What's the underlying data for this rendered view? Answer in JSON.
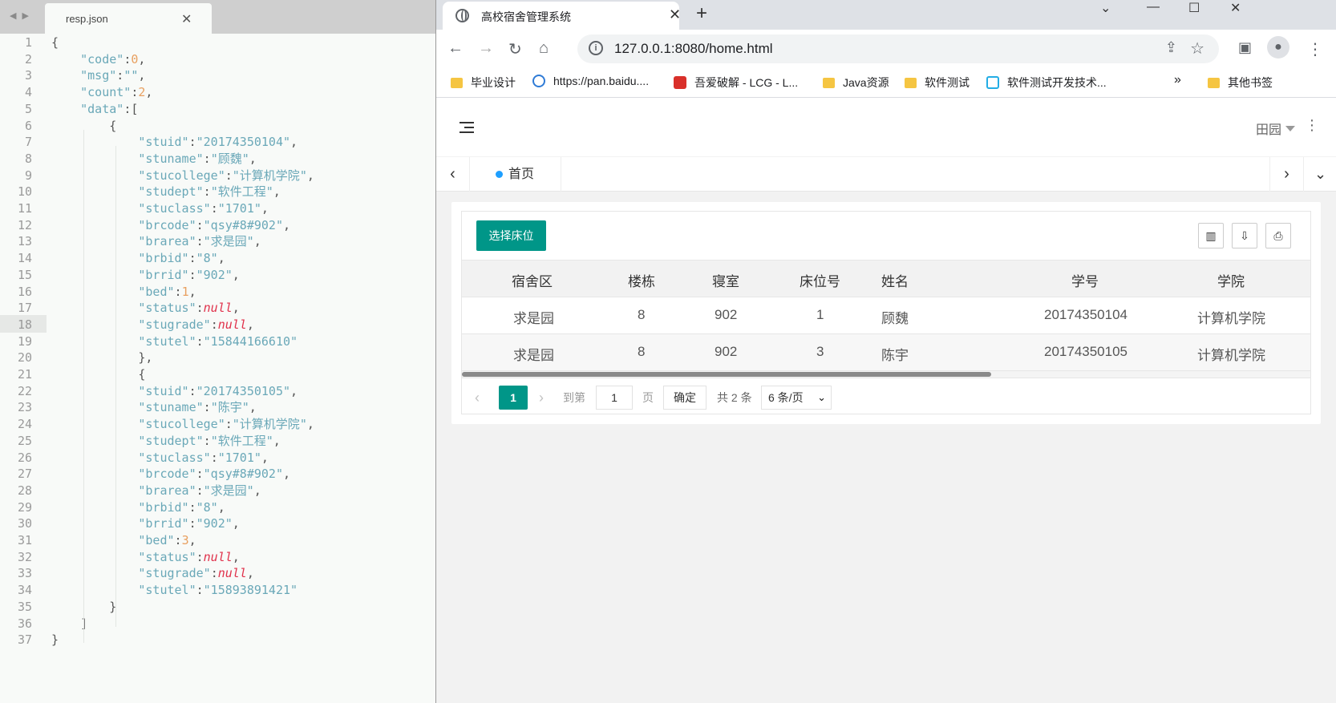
{
  "editor": {
    "file_name": "resp.json",
    "line_numbers": [
      "1",
      "2",
      "3",
      "4",
      "5",
      "6",
      "7",
      "8",
      "9",
      "10",
      "11",
      "12",
      "13",
      "14",
      "15",
      "16",
      "17",
      "18",
      "19",
      "20",
      "21",
      "22",
      "23",
      "24",
      "25",
      "26",
      "27",
      "28",
      "29",
      "30",
      "31",
      "32",
      "33",
      "34",
      "35",
      "36",
      "37"
    ],
    "lines": [
      [
        [
          "p",
          "{"
        ]
      ],
      [
        [
          "p",
          "    "
        ],
        [
          "k",
          "\"code\""
        ],
        [
          "p",
          ":"
        ],
        [
          "n",
          "0"
        ],
        [
          "p",
          ","
        ]
      ],
      [
        [
          "p",
          "    "
        ],
        [
          "k",
          "\"msg\""
        ],
        [
          "p",
          ":"
        ],
        [
          "s",
          "\"\""
        ],
        [
          "p",
          ","
        ]
      ],
      [
        [
          "p",
          "    "
        ],
        [
          "k",
          "\"count\""
        ],
        [
          "p",
          ":"
        ],
        [
          "n",
          "2"
        ],
        [
          "p",
          ","
        ]
      ],
      [
        [
          "p",
          "    "
        ],
        [
          "k",
          "\"data\""
        ],
        [
          "p",
          ":["
        ]
      ],
      [
        [
          "p",
          "        {"
        ]
      ],
      [
        [
          "p",
          "            "
        ],
        [
          "k",
          "\"stuid\""
        ],
        [
          "p",
          ":"
        ],
        [
          "s",
          "\"20174350104\""
        ],
        [
          "p",
          ","
        ]
      ],
      [
        [
          "p",
          "            "
        ],
        [
          "k",
          "\"stuname\""
        ],
        [
          "p",
          ":"
        ],
        [
          "s",
          "\"顾魏\""
        ],
        [
          "p",
          ","
        ]
      ],
      [
        [
          "p",
          "            "
        ],
        [
          "k",
          "\"stucollege\""
        ],
        [
          "p",
          ":"
        ],
        [
          "s",
          "\"计算机学院\""
        ],
        [
          "p",
          ","
        ]
      ],
      [
        [
          "p",
          "            "
        ],
        [
          "k",
          "\"studept\""
        ],
        [
          "p",
          ":"
        ],
        [
          "s",
          "\"软件工程\""
        ],
        [
          "p",
          ","
        ]
      ],
      [
        [
          "p",
          "            "
        ],
        [
          "k",
          "\"stuclass\""
        ],
        [
          "p",
          ":"
        ],
        [
          "s",
          "\"1701\""
        ],
        [
          "p",
          ","
        ]
      ],
      [
        [
          "p",
          "            "
        ],
        [
          "k",
          "\"brcode\""
        ],
        [
          "p",
          ":"
        ],
        [
          "s",
          "\"qsy#8#902\""
        ],
        [
          "p",
          ","
        ]
      ],
      [
        [
          "p",
          "            "
        ],
        [
          "k",
          "\"brarea\""
        ],
        [
          "p",
          ":"
        ],
        [
          "s",
          "\"求是园\""
        ],
        [
          "p",
          ","
        ]
      ],
      [
        [
          "p",
          "            "
        ],
        [
          "k",
          "\"brbid\""
        ],
        [
          "p",
          ":"
        ],
        [
          "s",
          "\"8\""
        ],
        [
          "p",
          ","
        ]
      ],
      [
        [
          "p",
          "            "
        ],
        [
          "k",
          "\"brrid\""
        ],
        [
          "p",
          ":"
        ],
        [
          "s",
          "\"902\""
        ],
        [
          "p",
          ","
        ]
      ],
      [
        [
          "p",
          "            "
        ],
        [
          "k",
          "\"bed\""
        ],
        [
          "p",
          ":"
        ],
        [
          "n",
          "1"
        ],
        [
          "p",
          ","
        ]
      ],
      [
        [
          "p",
          "            "
        ],
        [
          "k",
          "\"status\""
        ],
        [
          "p",
          ":"
        ],
        [
          "nl",
          "null"
        ],
        [
          "p",
          ","
        ]
      ],
      [
        [
          "p",
          "            "
        ],
        [
          "k",
          "\"stugrade\""
        ],
        [
          "p",
          ":"
        ],
        [
          "nl",
          "null"
        ],
        [
          "p",
          ","
        ]
      ],
      [
        [
          "p",
          "            "
        ],
        [
          "k",
          "\"stutel\""
        ],
        [
          "p",
          ":"
        ],
        [
          "s",
          "\"15844166610\""
        ]
      ],
      [
        [
          "p",
          "            },"
        ]
      ],
      [
        [
          "p",
          "            {"
        ]
      ],
      [
        [
          "p",
          "            "
        ],
        [
          "k",
          "\"stuid\""
        ],
        [
          "p",
          ":"
        ],
        [
          "s",
          "\"20174350105\""
        ],
        [
          "p",
          ","
        ]
      ],
      [
        [
          "p",
          "            "
        ],
        [
          "k",
          "\"stuname\""
        ],
        [
          "p",
          ":"
        ],
        [
          "s",
          "\"陈宇\""
        ],
        [
          "p",
          ","
        ]
      ],
      [
        [
          "p",
          "            "
        ],
        [
          "k",
          "\"stucollege\""
        ],
        [
          "p",
          ":"
        ],
        [
          "s",
          "\"计算机学院\""
        ],
        [
          "p",
          ","
        ]
      ],
      [
        [
          "p",
          "            "
        ],
        [
          "k",
          "\"studept\""
        ],
        [
          "p",
          ":"
        ],
        [
          "s",
          "\"软件工程\""
        ],
        [
          "p",
          ","
        ]
      ],
      [
        [
          "p",
          "            "
        ],
        [
          "k",
          "\"stuclass\""
        ],
        [
          "p",
          ":"
        ],
        [
          "s",
          "\"1701\""
        ],
        [
          "p",
          ","
        ]
      ],
      [
        [
          "p",
          "            "
        ],
        [
          "k",
          "\"brcode\""
        ],
        [
          "p",
          ":"
        ],
        [
          "s",
          "\"qsy#8#902\""
        ],
        [
          "p",
          ","
        ]
      ],
      [
        [
          "p",
          "            "
        ],
        [
          "k",
          "\"brarea\""
        ],
        [
          "p",
          ":"
        ],
        [
          "s",
          "\"求是园\""
        ],
        [
          "p",
          ","
        ]
      ],
      [
        [
          "p",
          "            "
        ],
        [
          "k",
          "\"brbid\""
        ],
        [
          "p",
          ":"
        ],
        [
          "s",
          "\"8\""
        ],
        [
          "p",
          ","
        ]
      ],
      [
        [
          "p",
          "            "
        ],
        [
          "k",
          "\"brrid\""
        ],
        [
          "p",
          ":"
        ],
        [
          "s",
          "\"902\""
        ],
        [
          "p",
          ","
        ]
      ],
      [
        [
          "p",
          "            "
        ],
        [
          "k",
          "\"bed\""
        ],
        [
          "p",
          ":"
        ],
        [
          "n",
          "3"
        ],
        [
          "p",
          ","
        ]
      ],
      [
        [
          "p",
          "            "
        ],
        [
          "k",
          "\"status\""
        ],
        [
          "p",
          ":"
        ],
        [
          "nl",
          "null"
        ],
        [
          "p",
          ","
        ]
      ],
      [
        [
          "p",
          "            "
        ],
        [
          "k",
          "\"stugrade\""
        ],
        [
          "p",
          ":"
        ],
        [
          "nl",
          "null"
        ],
        [
          "p",
          ","
        ]
      ],
      [
        [
          "p",
          "            "
        ],
        [
          "k",
          "\"stutel\""
        ],
        [
          "p",
          ":"
        ],
        [
          "s",
          "\"15893891421\""
        ]
      ],
      [
        [
          "p",
          "        }"
        ]
      ],
      [
        [
          "p",
          "    ]"
        ]
      ],
      [
        [
          "p",
          "}"
        ]
      ]
    ]
  },
  "browser": {
    "tab_title": "高校宿舍管理系统",
    "url": "127.0.0.1:8080/home.html",
    "bookmarks": [
      {
        "label": "毕业设计",
        "icon": "folder-icon"
      },
      {
        "label": "https://pan.baidu....",
        "icon": "baidu-pan-icon"
      },
      {
        "label": "吾爱破解 - LCG - L...",
        "icon": "52pojie-icon"
      },
      {
        "label": "Java资源",
        "icon": "folder-icon"
      },
      {
        "label": "软件测试",
        "icon": "folder-icon"
      },
      {
        "label": "软件测试开发技术...",
        "icon": "bilibili-icon"
      }
    ],
    "bookmarks_overflow": "»",
    "other_bookmarks": "其他书签"
  },
  "app": {
    "user_name": "田园",
    "home_tab": "首页",
    "select_bed_label": "选择床位",
    "columns": [
      "宿舍区",
      "楼栋",
      "寝室",
      "床位号",
      "姓名",
      "学号",
      "学院"
    ],
    "rows": [
      [
        "求是园",
        "8",
        "902",
        "1",
        "顾魏",
        "20174350104",
        "计算机学院"
      ],
      [
        "求是园",
        "8",
        "902",
        "3",
        "陈宇",
        "20174350105",
        "计算机学院"
      ]
    ],
    "pager": {
      "current": "1",
      "goto_label": "到第",
      "goto_value": "1",
      "page_label": "页",
      "ok_label": "确定",
      "total": "共 2 条",
      "page_size": "6 条/页"
    }
  },
  "colors": {
    "accent": "#009688",
    "tab_dot": "#1e9fff",
    "json_key": "#6aa8b8",
    "json_number": "#e8a060",
    "json_null": "#e0304a"
  }
}
